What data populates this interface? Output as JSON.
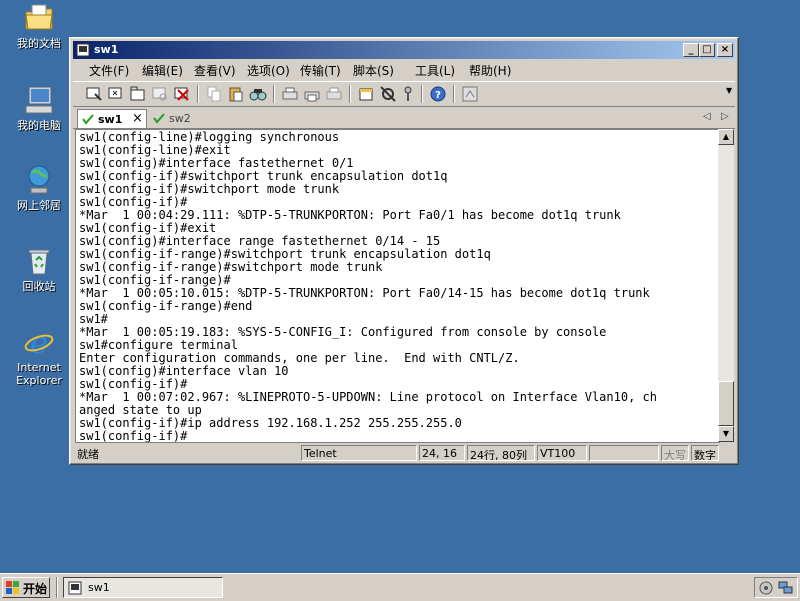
{
  "desktop": {
    "icons": [
      {
        "label": "我的文档",
        "icon": "my-documents-icon"
      },
      {
        "label": "我的电脑",
        "icon": "my-computer-icon"
      },
      {
        "label": "网上邻居",
        "icon": "network-places-icon"
      },
      {
        "label": "回收站",
        "icon": "recycle-bin-icon"
      },
      {
        "label_lines": [
          "Internet",
          "Explorer"
        ],
        "icon": "internet-explorer-icon"
      }
    ]
  },
  "window": {
    "title": "sw1",
    "menu": [
      "文件(F)",
      "编辑(E)",
      "查看(V)",
      "选项(O)",
      "传输(T)",
      "脚本(S)",
      "工具(L)",
      "帮助(H)"
    ],
    "tabs": [
      {
        "label": "sw1",
        "active": true
      },
      {
        "label": "sw2",
        "active": false
      }
    ],
    "terminal_lines": [
      "sw1(config-line)#logging synchronous",
      "sw1(config-line)#exit",
      "sw1(config)#interface fastethernet 0/1",
      "sw1(config-if)#switchport trunk encapsulation dot1q",
      "sw1(config-if)#switchport mode trunk",
      "sw1(config-if)#",
      "*Mar  1 00:04:29.111: %DTP-5-TRUNKPORTON: Port Fa0/1 has become dot1q trunk",
      "sw1(config-if)#exit",
      "sw1(config)#interface range fastethernet 0/14 - 15",
      "sw1(config-if-range)#switchport trunk encapsulation dot1q",
      "sw1(config-if-range)#switchport mode trunk",
      "sw1(config-if-range)#",
      "*Mar  1 00:05:10.015: %DTP-5-TRUNKPORTON: Port Fa0/14-15 has become dot1q trunk",
      "sw1(config-if-range)#end",
      "sw1#",
      "*Mar  1 00:05:19.183: %SYS-5-CONFIG_I: Configured from console by console",
      "sw1#configure terminal",
      "Enter configuration commands, one per line.  End with CNTL/Z.",
      "sw1(config)#interface vlan 10",
      "sw1(config-if)#",
      "*Mar  1 00:07:02.967: %LINEPROTO-5-UPDOWN: Line protocol on Interface Vlan10, ch",
      "anged state to up",
      "sw1(config-if)#ip address 192.168.1.252 255.255.255.0",
      "sw1(config-if)#"
    ],
    "status": {
      "ready": "就绪",
      "protocol": "Telnet",
      "cursor": "24, 16",
      "size": "24行, 80列",
      "emulation": "VT100",
      "empty": "",
      "caps": "大写",
      "num": "数字"
    }
  },
  "taskbar": {
    "start_label": "开始",
    "task_label": "sw1"
  },
  "colors": {
    "desktop": "#3a6ea5",
    "title_start": "#0a246a",
    "title_end": "#a6caf0",
    "chrome": "#d4d0c8"
  }
}
